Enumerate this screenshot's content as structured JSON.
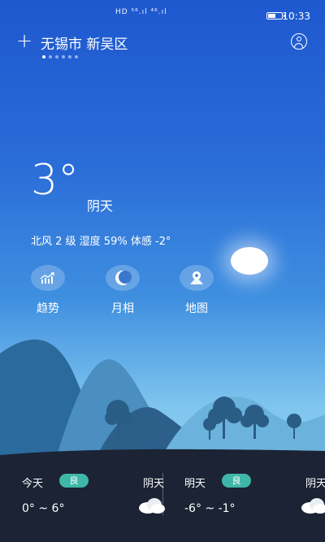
{
  "status_bar": {
    "time": "10:33",
    "network": "HD ⁵⁶.ıl ⁴⁶.ıl",
    "battery_level": 0.6
  },
  "location": {
    "city": "无锡市 新吴区",
    "page_count": 6,
    "active_page": 0
  },
  "current": {
    "temperature": "3°",
    "condition": "阴天",
    "details": "北风 2 级  湿度 59%  体感 -2°"
  },
  "shortcuts": [
    {
      "label": "趋势",
      "icon": "trend-chart-icon"
    },
    {
      "label": "月相",
      "icon": "moon-icon"
    },
    {
      "label": "地图",
      "icon": "map-pin-icon"
    }
  ],
  "forecast": [
    {
      "day": "今天",
      "aqi": "良",
      "condition": "阴天",
      "range": "0° ~ 6°",
      "icon": "cloud-icon"
    },
    {
      "day": "明天",
      "aqi": "良",
      "condition": "阴天",
      "range": "-6° ~ -1°",
      "icon": "cloud-icon"
    }
  ],
  "colors": {
    "aqi_good": "#3fb7a8",
    "panel": "#1b2334",
    "sky_top": "#1e58cf",
    "sky_bottom": "#a7dcf4"
  }
}
